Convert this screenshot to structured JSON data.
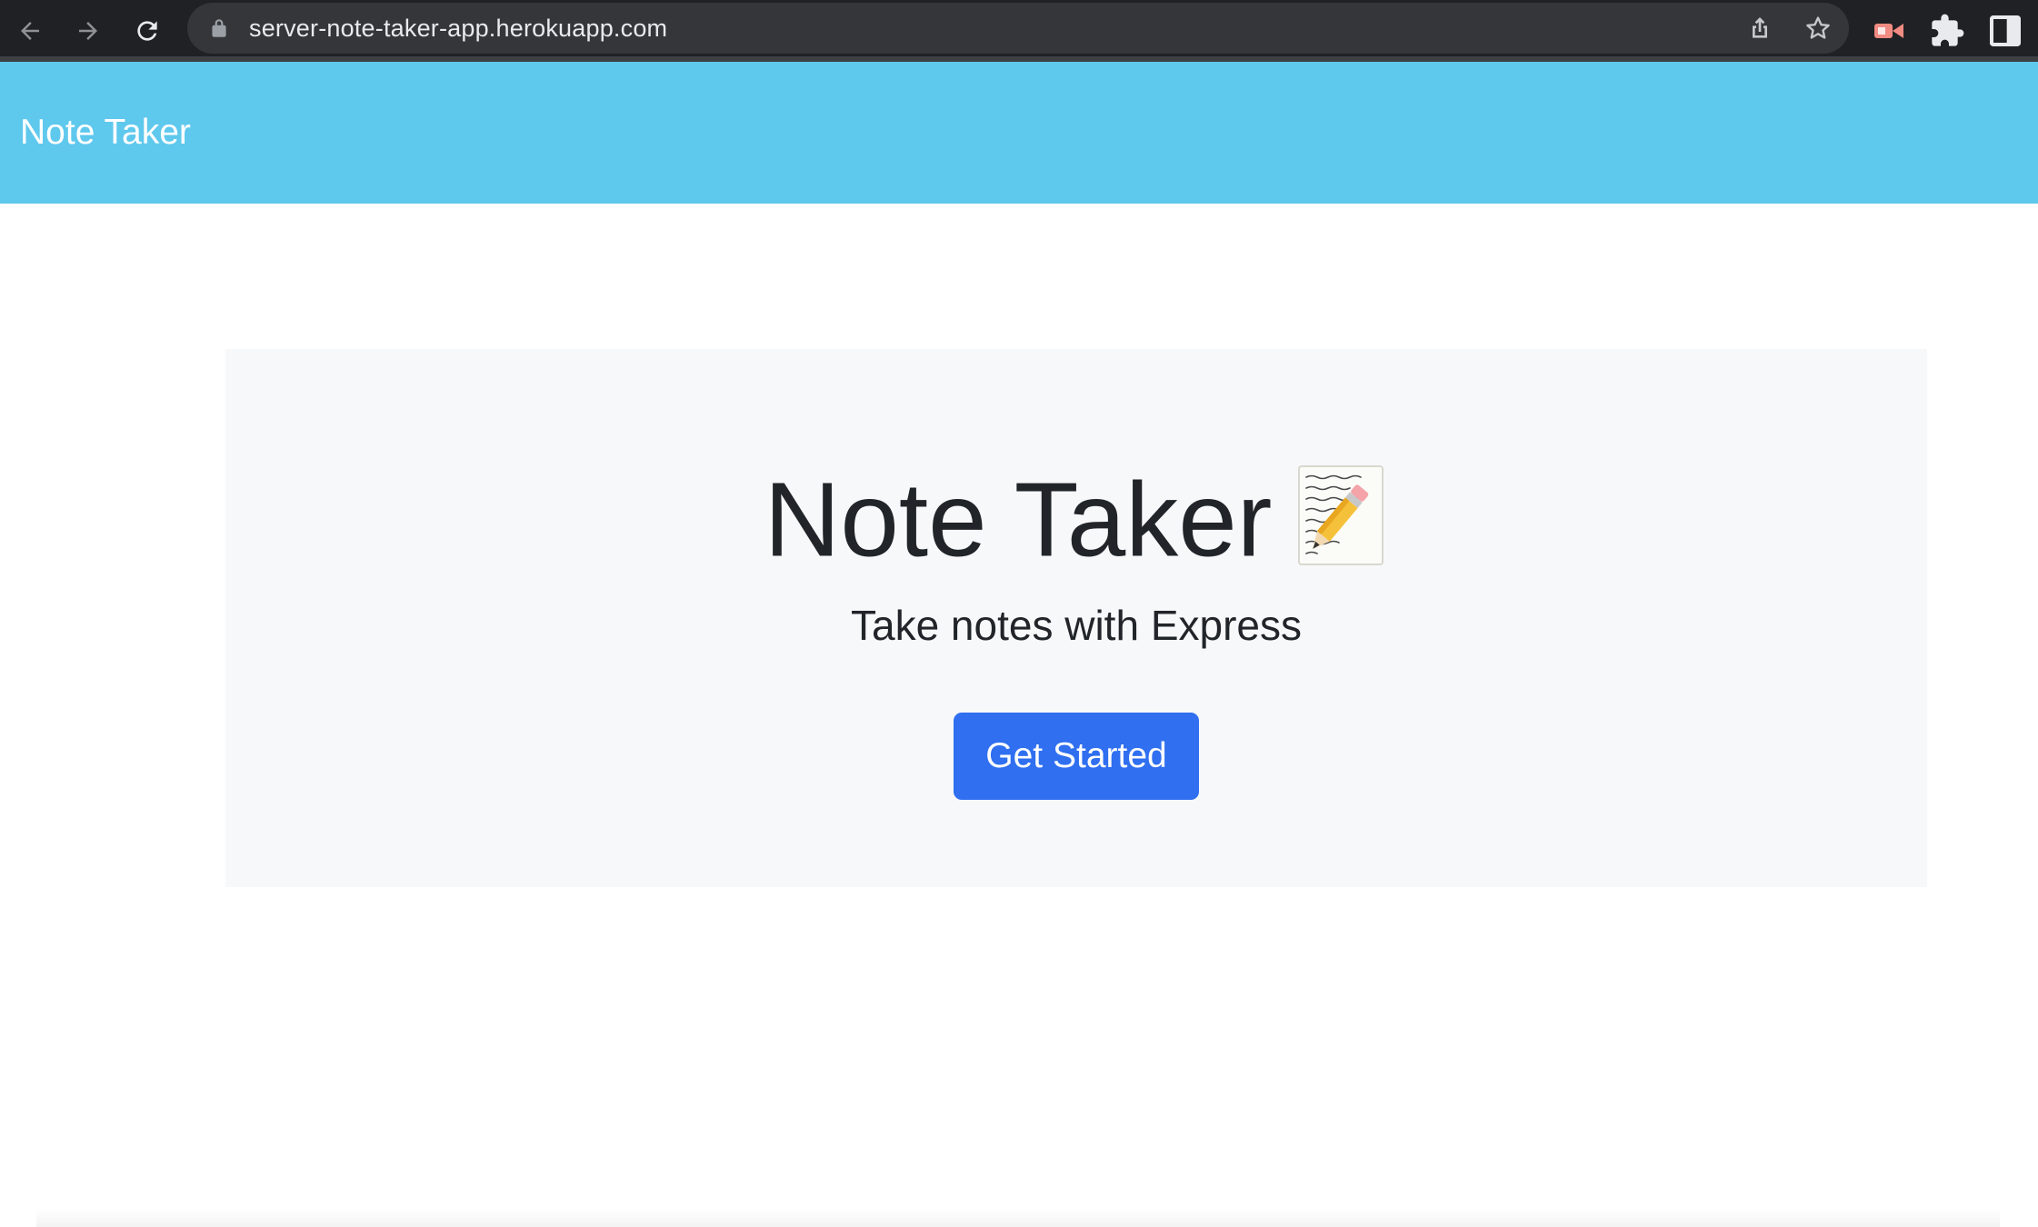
{
  "browser": {
    "url": "server-note-taker-app.herokuapp.com",
    "icons": {
      "back": "arrow-left-icon",
      "forward": "arrow-right-icon",
      "reload": "reload-icon",
      "lock": "lock-icon",
      "share": "share-icon",
      "bookmark": "star-icon",
      "extension_active": "video-camera-icon",
      "extensions": "puzzle-icon",
      "side_panel": "side-panel-icon"
    }
  },
  "navbar": {
    "brand": "Note Taker",
    "color": "#5fc8ed"
  },
  "hero": {
    "title": "Note Taker",
    "title_icon": "memo-icon",
    "subtitle": "Take notes with Express",
    "button_label": "Get Started",
    "button_color": "#2f6ff0"
  }
}
